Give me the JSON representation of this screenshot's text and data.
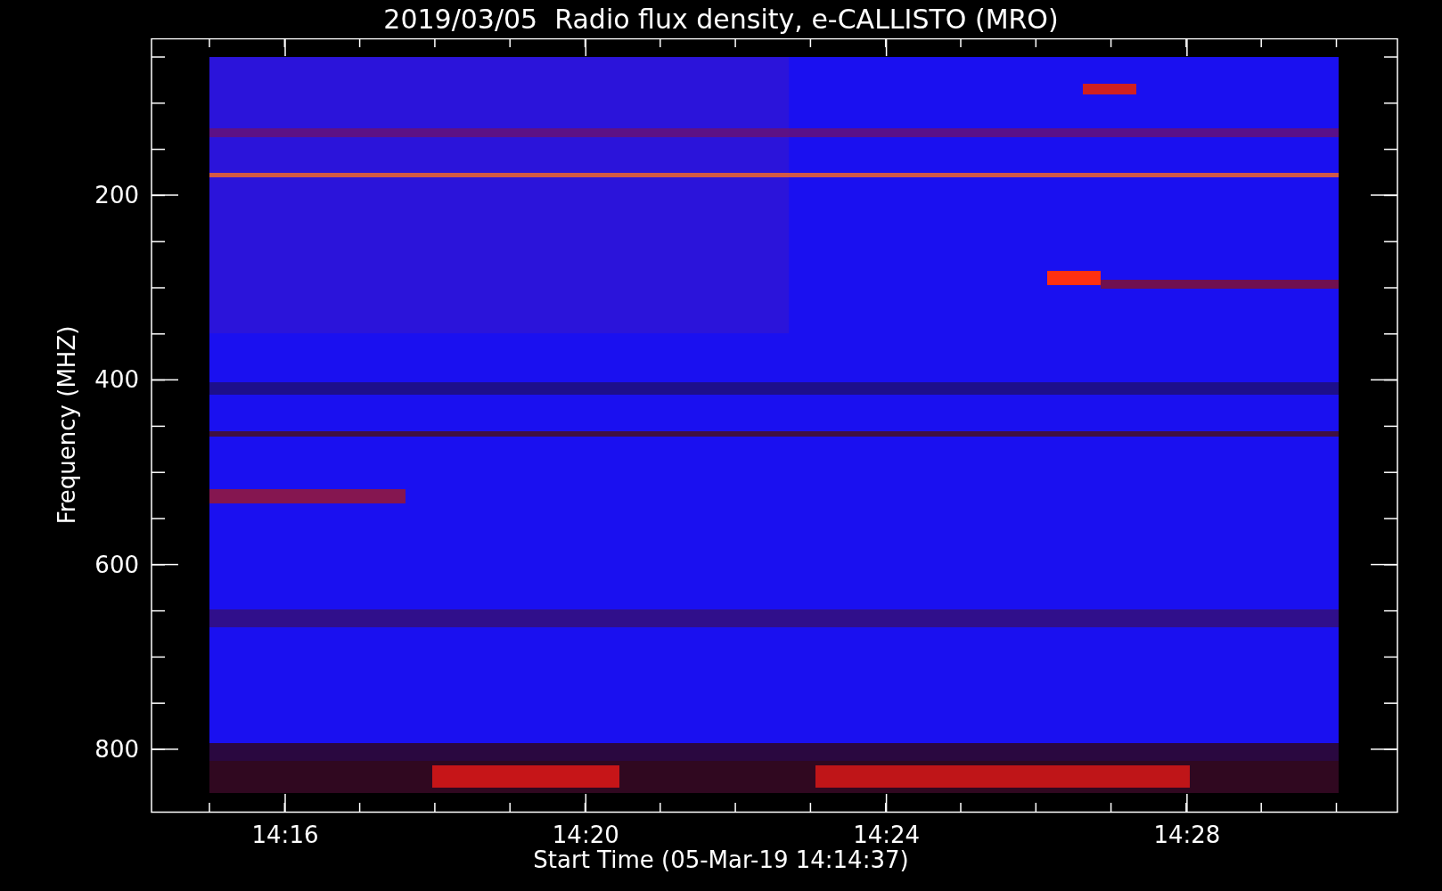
{
  "title": "2019/03/05  Radio flux density, e-CALLISTO (MRO)",
  "y_axis": {
    "label": "Frequency (MHZ)",
    "ticks": [
      "200",
      "400",
      "600",
      "800"
    ]
  },
  "x_axis": {
    "label": "Start Time (05-Mar-19 14:14:37)",
    "ticks": [
      "14:16",
      "14:20",
      "14:24",
      "14:28"
    ]
  }
}
